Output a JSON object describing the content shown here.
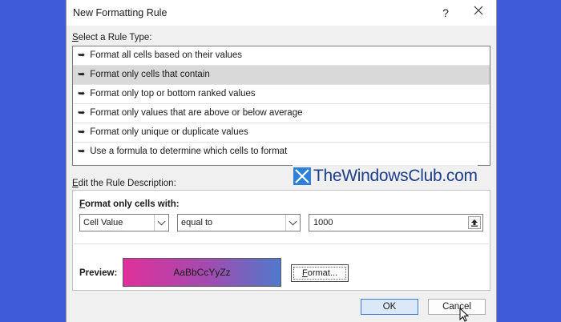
{
  "dialog": {
    "title": "New Formatting Rule",
    "help_glyph": "?",
    "close_glyph": "✕"
  },
  "rule_type": {
    "label_prefix": "S",
    "label_rest": "elect a Rule Type:",
    "items": [
      {
        "label": "Format all cells based on their values",
        "selected": false
      },
      {
        "label": "Format only cells that contain",
        "selected": true
      },
      {
        "label": "Format only top or bottom ranked values",
        "selected": false
      },
      {
        "label": "Format only values that are above or below average",
        "selected": false
      },
      {
        "label": "Format only unique or duplicate values",
        "selected": false
      },
      {
        "label": "Use a formula to determine which cells to format",
        "selected": false
      }
    ],
    "arrow_glyph": "➥"
  },
  "description": {
    "label_prefix": "E",
    "label_rest": "dit the Rule Description:",
    "format_title_prefix": "F",
    "format_title_rest": "ormat only cells with:",
    "condition_field": "Cell Value",
    "operator": "equal to",
    "value": "1000",
    "preview_label": "Preview:",
    "preview_text": "AaBbCcYyZz",
    "format_button_prefix": "F",
    "format_button_rest": "ormat..."
  },
  "buttons": {
    "ok": "OK",
    "cancel": "Cancel"
  },
  "watermark": {
    "text": "TheWindowsClub.com"
  },
  "colors": {
    "desktop": "#3f5bd8",
    "preview_start": "#e0309b",
    "preview_end": "#4f79cc",
    "selected_row": "#d9d9d9",
    "ok_border": "#3a7bd5"
  }
}
